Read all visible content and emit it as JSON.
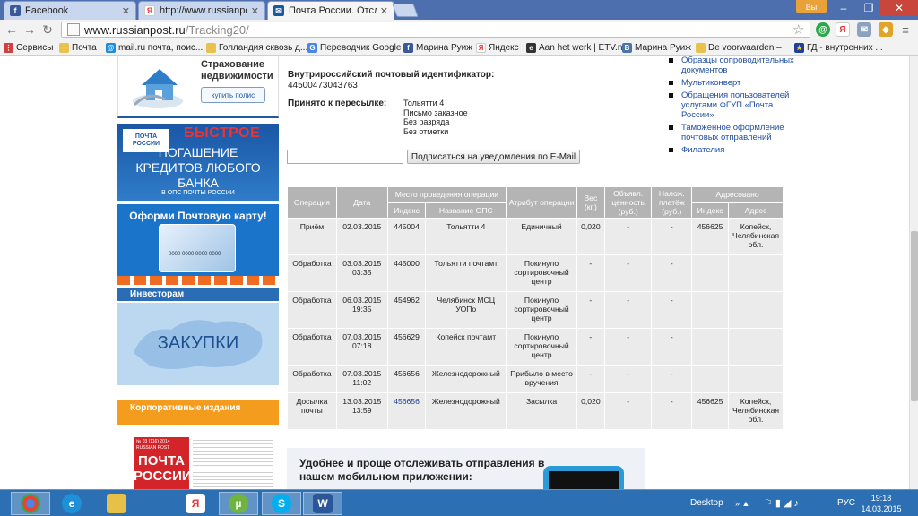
{
  "browser": {
    "tabs": [
      {
        "title": "Facebook",
        "icon": "facebook-icon",
        "active": false
      },
      {
        "title": "http://www.russianpost.ru",
        "icon": "yandex-icon",
        "active": false
      },
      {
        "title": "Почта России. Отслеживание",
        "icon": "russianpost-icon",
        "active": true
      }
    ],
    "user_badge": "Вы",
    "url_host": "www.russianpost.ru",
    "url_path": "/Tracking20/"
  },
  "bookmarks": [
    {
      "label": "Сервисы",
      "icon": "apps-icon"
    },
    {
      "label": "Почта",
      "icon": "folder-icon"
    },
    {
      "label": "mail.ru почта, поис...",
      "icon": "mailru-icon"
    },
    {
      "label": "Голландия сквозь д...",
      "icon": "folder-icon"
    },
    {
      "label": "Переводчик Google",
      "icon": "translate-icon"
    },
    {
      "label": "Марина Руиж",
      "icon": "facebook-icon"
    },
    {
      "label": "Яндекс",
      "icon": "yandex-icon"
    },
    {
      "label": "Aan het werk | ETV.nl",
      "icon": "etv-icon"
    },
    {
      "label": "Марина Руиж",
      "icon": "vk-icon"
    },
    {
      "label": "De voorwaarden –",
      "icon": "folder-icon"
    },
    {
      "label": "ГД - внутренних ...",
      "icon": "eu-icon"
    }
  ],
  "sidebar": {
    "insurance_title": "Страхование недвижимости",
    "insurance_button": "купить полис",
    "credit_logo": "ПОЧТА РОССИИ",
    "credit_fast": "БЫСТРОЕ",
    "credit_lines": [
      "ПОГАШЕНИЕ",
      "КРЕДИТОВ ЛЮБОГО",
      "БАНКА"
    ],
    "credit_small": "В ОПС ПОЧТЫ РОССИИ",
    "card_title": "Оформи Почтовую карту!",
    "card_number": "0000 0000 0000 0000",
    "investors": "Инвесторам",
    "purchases": "ЗАКУПКИ",
    "corporate": "Корпоративные издания",
    "magazine_issue": "№ 03 (116) 2014",
    "magazine_brand": "RUSSIAN POST",
    "magazine_title": "ПОЧТА РОССИИ"
  },
  "tracking": {
    "id_label": "Внутрироссийский почтовый идентификатор:",
    "id_value": "44500473043763",
    "accepted_label": "Принято к пересылке:",
    "accepted_values": [
      "Тольятти 4",
      "Письмо заказное",
      "Без разряда",
      "Без отметки"
    ],
    "subscribe_button": "Подписаться на уведомления по E-Mail"
  },
  "right_links": [
    "Образцы сопроводительных документов",
    "Мультиконверт",
    "Обращения пользователей услугами ФГУП «Почта России»",
    "Таможенное оформление почтовых отправлений",
    "Филателия"
  ],
  "table": {
    "h_operation": "Операция",
    "h_date": "Дата",
    "h_place": "Место проведения операции",
    "h_attr": "Атрибут операции",
    "h_weight": "Вес (кг.)",
    "h_value": "Объявл. ценность (руб.)",
    "h_cod": "Налож. платёж (руб.)",
    "h_addressed": "Адресовано",
    "h_index": "Индекс",
    "h_ops_name": "Название ОПС",
    "h_index2": "Индекс",
    "h_address": "Адрес",
    "rows": [
      {
        "op": "Приём",
        "date": "02.03.2015",
        "index": "445004",
        "name": "Тольятти 4",
        "attr": "Единичный",
        "weight": "0,020",
        "value": "-",
        "cod": "-",
        "to_index": "456625",
        "address": "Копейск, Челябинская обл."
      },
      {
        "op": "Обработка",
        "date": "03.03.2015 03:35",
        "index": "445000",
        "name": "Тольятти почтамт",
        "attr": "Покинуло сортировочный центр",
        "weight": "-",
        "value": "-",
        "cod": "-",
        "to_index": "",
        "address": ""
      },
      {
        "op": "Обработка",
        "date": "06.03.2015 19:35",
        "index": "454962",
        "name": "Челябинск МСЦ УОПо",
        "attr": "Покинуло сортировочный центр",
        "weight": "-",
        "value": "-",
        "cod": "-",
        "to_index": "",
        "address": ""
      },
      {
        "op": "Обработка",
        "date": "07.03.2015 07:18",
        "index": "456629",
        "name": "Копейск почтамт",
        "attr": "Покинуло сортировочный центр",
        "weight": "-",
        "value": "-",
        "cod": "-",
        "to_index": "",
        "address": ""
      },
      {
        "op": "Обработка",
        "date": "07.03.2015 11:02",
        "index": "456656",
        "name": "Железнодорожный",
        "attr": "Прибыло в место вручения",
        "weight": "-",
        "value": "-",
        "cod": "-",
        "to_index": "",
        "address": ""
      },
      {
        "op": "Досылка почты",
        "date": "13.03.2015 13:59",
        "index": "456656",
        "name": "Железнодорожный",
        "attr": "Засылка",
        "weight": "0,020",
        "value": "-",
        "cod": "-",
        "to_index": "456625",
        "address": "Копейск, Челябинская обл."
      }
    ]
  },
  "promo": {
    "text": "Удобнее и проще отслеживать отправления в нашем мобильном приложении:"
  },
  "taskbar": {
    "apps": [
      "chrome-icon",
      "ie-icon",
      "explorer-icon",
      "yandex-browser-icon",
      "utorrent-icon",
      "skype-icon",
      "word-icon"
    ],
    "desktop_label": "Desktop",
    "lang": "РУС",
    "time": "19:18",
    "date": "14.03.2015"
  }
}
